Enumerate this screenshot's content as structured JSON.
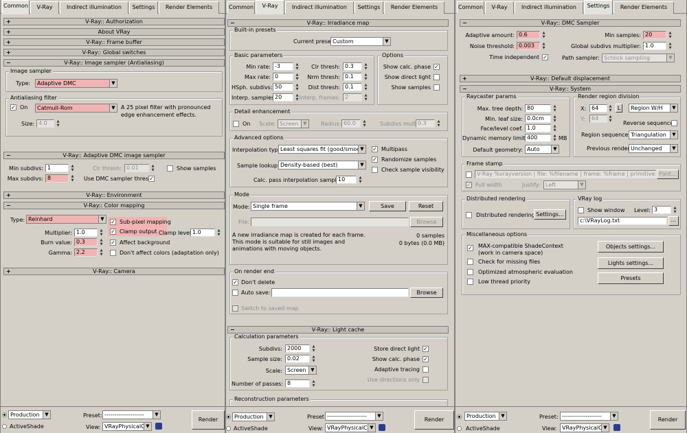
{
  "tabs": {
    "common": "Common",
    "vray": "V-Ray",
    "indirect": "Indirect illumination",
    "settings": "Settings",
    "render_elements": "Render Elements"
  },
  "panel1": {
    "authorization": "V-Ray:: Authorization",
    "about": "About VRay",
    "frame_buffer": "V-Ray:: Frame buffer",
    "global_switches": "V-Ray:: Global switches",
    "image_sampler": "V-Ray:: Image sampler (Antialiasing)",
    "image_sampler_group": "Image sampler",
    "type_label": "Type:",
    "type_value": "Adaptive DMC",
    "aa_group": "Antialiasing filter",
    "on_label": "On",
    "filter_value": "Catmull-Rom",
    "filter_desc": "A 25 pixel filter with pronounced edge enhancement effects.",
    "size_label": "Size:",
    "size_value": "4.0",
    "dmc_sampler": "V-Ray:: Adaptive DMC image sampler",
    "min_subdivs_label": "Min subdivs:",
    "min_subdivs": "1",
    "max_subdivs_label": "Max subdivs:",
    "max_subdivs": "8",
    "clr_thresh_label": "Clr thresh:",
    "clr_thresh": "0.01",
    "show_samples": "Show samples",
    "use_dmc": "Use DMC sampler thresh.",
    "environment": "V-Ray:: Environment",
    "color_mapping": "V-Ray:: Color mapping",
    "cm_type_label": "Type:",
    "cm_type": "Reinhard",
    "multiplier_label": "Multiplier:",
    "multiplier": "1.0",
    "burn_label": "Burn value:",
    "burn": "0.3",
    "gamma_label": "Gamma:",
    "gamma": "2.2",
    "subpixel": "Sub-pixel mapping",
    "clamp_output": "Clamp output",
    "clamp_level_label": "Clamp level:",
    "clamp_level": "1.0",
    "affect_bg": "Affect background",
    "dont_affect": "Don't affect colors (adaptation only)",
    "camera": "V-Ray:: Camera"
  },
  "panel2": {
    "irradiance": "V-Ray:: Irradiance map",
    "builtin_group": "Built-in presets",
    "current_preset_label": "Current preset:",
    "current_preset": "Custom",
    "basic_group": "Basic parameters",
    "min_rate_label": "Min rate:",
    "min_rate": "-3",
    "max_rate_label": "Max rate:",
    "max_rate": "0",
    "hsph_label": "HSph. subdivs:",
    "hsph": "50",
    "interp_label": "Interp. samples:",
    "interp": "20",
    "clr_label": "Clr thresh:",
    "clr": "0.3",
    "nrm_label": "Nrm thresh:",
    "nrm": "0.1",
    "dist_label": "Dist thresh:",
    "dist": "0.1",
    "frames_label": "Interp. frames:",
    "frames": "2",
    "options_group": "Options",
    "show_calc": "Show calc. phase",
    "show_direct": "Show direct light",
    "show_samples": "Show samples",
    "detail_group": "Detail enhancement",
    "on_label": "On",
    "scale_label": "Scale:",
    "scale": "Screen",
    "radius_label": "Radius:",
    "radius": "60.0",
    "subdivs_mult_label": "Subdivs mult.",
    "subdivs_mult": "0.3",
    "advanced_group": "Advanced options",
    "interp_type_label": "Interpolation type:",
    "interp_type": "Least squares fit (good/smooth",
    "multipass": "Multipass",
    "sample_lookup_label": "Sample lookup:",
    "sample_lookup": "Density-based (best)",
    "randomize": "Randomize samples",
    "check_vis": "Check sample visibility",
    "calc_pass_label": "Calc. pass interpolation samples:",
    "calc_pass": "10",
    "mode_group": "Mode",
    "mode_label": "Mode:",
    "mode": "Single frame",
    "save": "Save",
    "reset": "Reset",
    "file_label": "File:",
    "browse": "Browse",
    "mode_desc": "A new irradiance map is created for each frame. This mode is suitable for still images and animations with moving objects.",
    "samples_info": "0 samples",
    "bytes_info": "0 bytes (0.0 MB)",
    "render_end_group": "On render end",
    "dont_delete": "Don't delete",
    "auto_save": "Auto save:",
    "browse2": "Browse",
    "switch_saved": "Switch to saved map",
    "light_cache": "V-Ray:: Light cache",
    "calc_group": "Calculation parameters",
    "lc_subdivs_label": "Subdivs:",
    "lc_subdivs": "2000",
    "lc_size_label": "Sample size:",
    "lc_size": "0.02",
    "lc_scale_label": "Scale:",
    "lc_scale": "Screen",
    "lc_passes_label": "Number of passes:",
    "lc_passes": "8",
    "store_direct": "Store direct light",
    "lc_show_calc": "Show calc. phase",
    "adaptive_tracing": "Adaptive tracing",
    "use_dirs": "Use directions only",
    "recon_group": "Reconstruction parameters"
  },
  "panel3": {
    "dmc": "V-Ray:: DMC Sampler",
    "adaptive_label": "Adaptive amount:",
    "adaptive": "0.6",
    "noise_label": "Noise threshold:",
    "noise": "0.003",
    "time_indep": "Time independent",
    "min_samples_label": "Min samples:",
    "min_samples": "20",
    "global_mult_label": "Global subdivs multiplier:",
    "global_mult": "1.0",
    "path_sampler_label": "Path sampler:",
    "path_sampler": "Schlick sampling",
    "displacement": "V-Ray:: Default displacement",
    "system": "V-Ray:: System",
    "raycaster_group": "Raycaster params",
    "max_tree_label": "Max. tree depth:",
    "max_tree": "80",
    "min_leaf_label": "Min. leaf size:",
    "min_leaf": "0.0cm",
    "face_label": "Face/level coef.",
    "face": "1.0",
    "dyn_mem_label": "Dynamic memory limit:",
    "dyn_mem": "400",
    "mb": "MB",
    "def_geom_label": "Default geometry:",
    "def_geom": "Auto",
    "region_group": "Render region division",
    "x_label": "X:",
    "x_val": "64",
    "l_btn": "L",
    "y_label": "Y:",
    "y_val": "64",
    "region_wh": "Region W/H",
    "reverse_seq": "Reverse sequence",
    "region_seq_label": "Region sequence:",
    "region_seq": "Triangulation",
    "prev_render_label": "Previous render:",
    "prev_render": "Unchanged",
    "frame_stamp_group": "Frame stamp",
    "stamp_text": "V-Ray %vrayversion | file: %filename | frame: %frame | primitives: %primitive",
    "font_btn": "Font...",
    "full_width": "Full width",
    "justify_label": "Justify:",
    "justify": "Left",
    "dist_group": "Distributed rendering",
    "dist_render": "Distributed rendering",
    "settings_btn": "Settings...",
    "vlog_group": "VRay log",
    "show_window": "Show window",
    "level_label": "Level:",
    "level": "3",
    "log_path": "c:\\VRayLog.txt",
    "dots": "...",
    "misc_group": "Miscellaneous options",
    "max_compat": "MAX-compatible ShadeContext",
    "max_compat2": "(work in camera space)",
    "check_missing": "Check for missing files",
    "opt_atmo": "Optimized atmospheric evaluation",
    "low_thread": "Low thread priority",
    "objects_btn": "Objects settings...",
    "lights_btn": "Lights settings...",
    "presets_btn": "Presets"
  },
  "bottom": {
    "production": "Production",
    "activeshade": "ActiveShade",
    "preset_label": "Preset:",
    "preset_value": "--------------------",
    "view_label": "View:",
    "view_value": "VRayPhysicalC",
    "render": "Render"
  },
  "colors": {
    "panel": "#d4d0c8",
    "rollout": "#c8c4bc",
    "highlight": "#f0b4b4"
  }
}
